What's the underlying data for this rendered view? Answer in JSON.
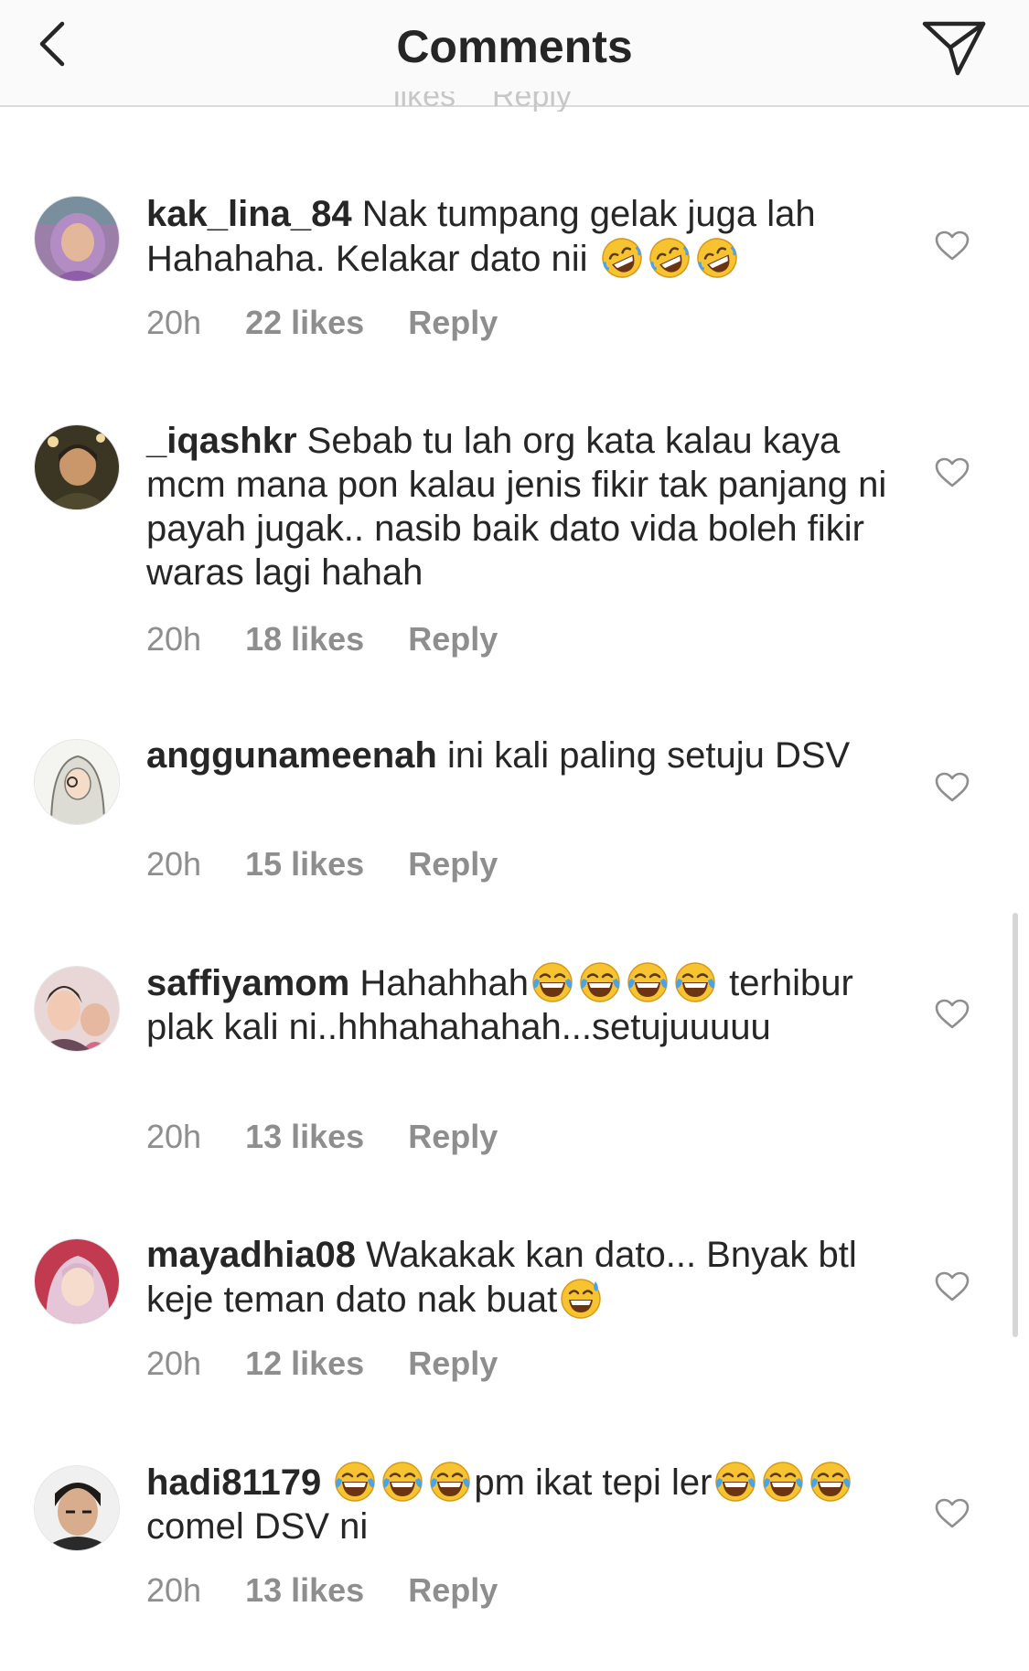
{
  "header": {
    "title": "Comments",
    "back_icon": "chevron-left-icon",
    "share_icon": "paper-plane-icon"
  },
  "partial_row": {
    "likes": "likes",
    "reply": "Reply"
  },
  "comments": [
    {
      "username": "kak_lina_84",
      "text_a": " Nak tumpang  gelak juga lah Hahahaha.  Kelakar dato nii ",
      "emojis": [
        "rolling-on-floor-laughing-emoji",
        "rolling-on-floor-laughing-emoji",
        "rolling-on-floor-laughing-emoji"
      ],
      "time": "20h",
      "likes": "22 likes",
      "reply": "Reply"
    },
    {
      "username": "_iqashkr",
      "text_a": " Sebab tu lah org kata kalau kaya mcm mana pon kalau jenis fikir tak panjang ni payah jugak.. nasib baik dato vida boleh fikir waras lagi hahah",
      "time": "20h",
      "likes": "18 likes",
      "reply": "Reply"
    },
    {
      "username": "anggunameenah",
      "text_a": " ini kali paling setuju DSV",
      "time": "20h",
      "likes": "15 likes",
      "reply": "Reply"
    },
    {
      "username": "saffiyamom",
      "text_a": " Hahahhah",
      "text_b": " terhibur plak kali ni..hhhahahahah...setujuuuuu",
      "emojis": [
        "tears-of-joy-emoji",
        "tears-of-joy-emoji",
        "tears-of-joy-emoji",
        "tears-of-joy-emoji"
      ],
      "time": "20h",
      "likes": "13 likes",
      "reply": "Reply"
    },
    {
      "username": "mayadhia08",
      "text_a": " Wakakak kan dato... Bnyak btl keje teman dato nak buat",
      "emojis": [
        "grinning-sweat-emoji"
      ],
      "time": "20h",
      "likes": "12 likes",
      "reply": "Reply"
    },
    {
      "username": "hadi81179",
      "text_a": "pm ikat tepi ler",
      "text_b": " comel DSV ni",
      "emojis": [
        "tears-of-joy-emoji",
        "tears-of-joy-emoji",
        "tears-of-joy-emoji",
        "tears-of-joy-emoji",
        "tears-of-joy-emoji",
        "tears-of-joy-emoji"
      ],
      "time": "20h",
      "likes": "13 likes",
      "reply": "Reply"
    }
  ],
  "colors": {
    "text": "#262626",
    "meta": "#8e8e8e",
    "header_bg": "#fafafa",
    "divider": "#dbdbdb",
    "emoji_yellow": "#f7c331",
    "tear_blue": "#4aa3e8"
  }
}
